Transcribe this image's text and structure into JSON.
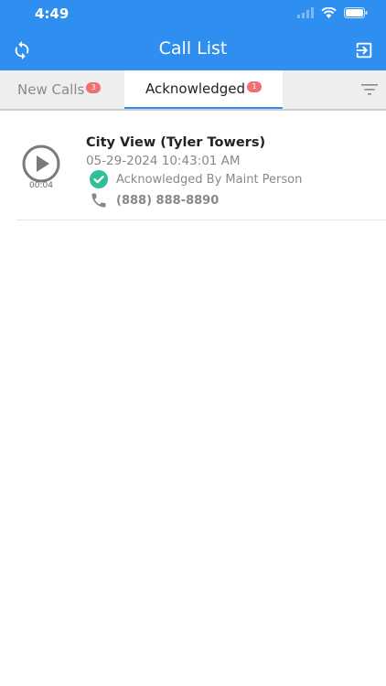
{
  "status_bar": {
    "time": "4:49"
  },
  "header": {
    "title": "Call List",
    "refresh_icon": "refresh-icon",
    "logout_icon": "logout-icon"
  },
  "tabs": [
    {
      "label": "New Calls",
      "badge": "3",
      "active": false
    },
    {
      "label": "Acknowledged",
      "badge": "1",
      "active": true
    }
  ],
  "calls": [
    {
      "name": "City View (Tyler Towers)",
      "datetime": "05-29-2024 10:43:01 AM",
      "duration": "00:04",
      "status": "Acknowledged By Maint Person",
      "phone": "(888) 888-8890"
    }
  ],
  "colors": {
    "header_bg": "#2e8ff0",
    "badge": "#f07070",
    "ack_check": "#2fbf98"
  }
}
